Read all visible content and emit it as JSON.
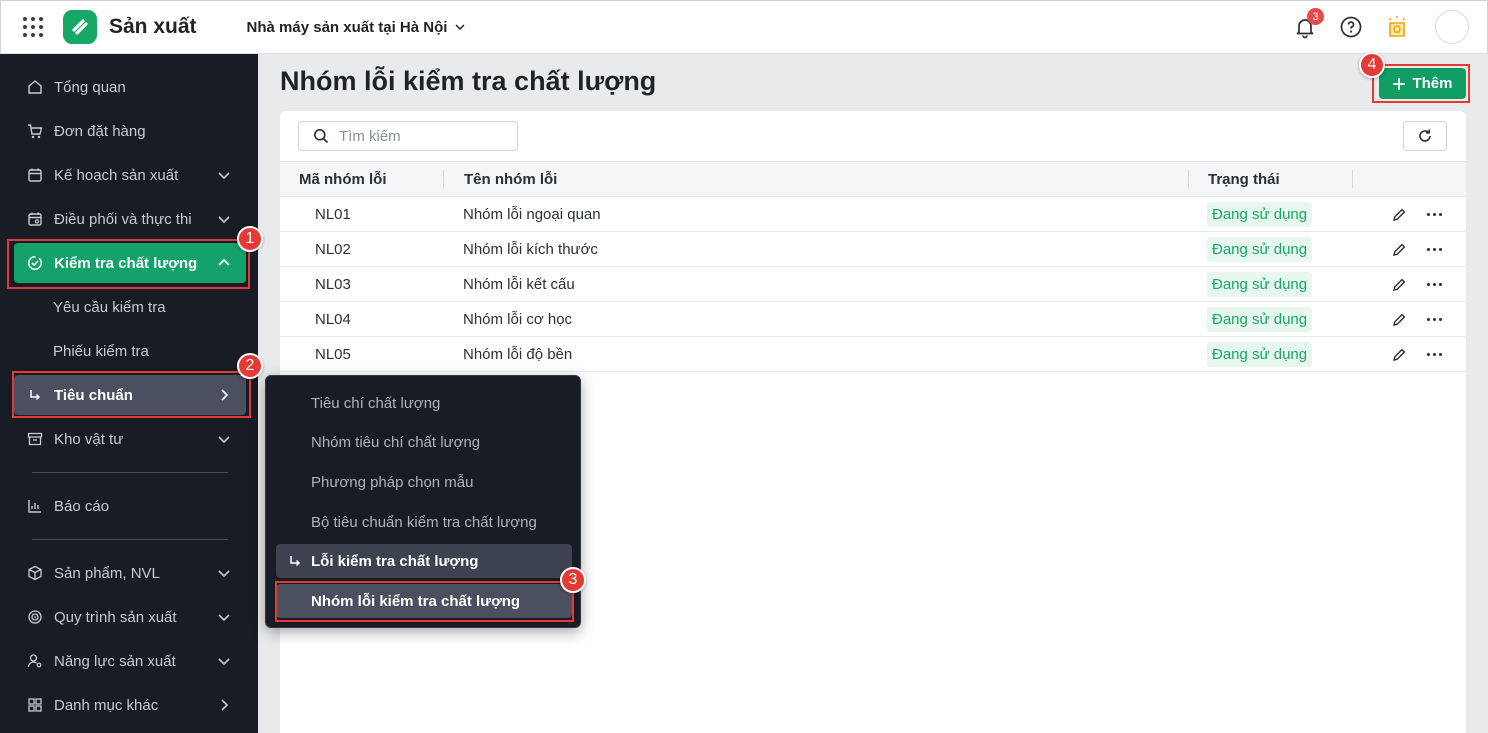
{
  "header": {
    "app_title": "Sản xuất",
    "factory": "Nhà máy sản xuất tại Hà Nội",
    "notification_count": "3"
  },
  "sidebar": {
    "items": [
      {
        "label": "Tổng quan",
        "icon": "home-icon"
      },
      {
        "label": "Đơn đặt hàng",
        "icon": "cart-icon"
      },
      {
        "label": "Kế hoạch sản xuất",
        "icon": "calendar-icon"
      },
      {
        "label": "Điều phối và thực thi",
        "icon": "calendar-gear-icon"
      },
      {
        "label": "Kiểm tra chất lượng",
        "icon": "check-circle-icon"
      },
      {
        "label": "Yêu cầu kiểm tra"
      },
      {
        "label": "Phiếu kiểm tra"
      },
      {
        "label": "Tiêu chuẩn",
        "icon": "subitem-arrow-icon"
      },
      {
        "label": "Kho vật tư",
        "icon": "archive-icon"
      },
      {
        "label": "Báo cáo",
        "icon": "chart-icon"
      },
      {
        "label": "Sản phẩm, NVL",
        "icon": "cube-icon"
      },
      {
        "label": "Quy trình sản xuất",
        "icon": "process-icon"
      },
      {
        "label": "Năng lực sản xuất",
        "icon": "user-gear-icon"
      },
      {
        "label": "Danh mục khác",
        "icon": "grid-icon"
      }
    ]
  },
  "flyout": {
    "items": [
      {
        "label": "Tiêu chí chất lượng"
      },
      {
        "label": "Nhóm tiêu chí chất lượng"
      },
      {
        "label": "Phương pháp chọn mẫu"
      },
      {
        "label": "Bộ tiêu chuẩn kiểm tra chất lượng"
      },
      {
        "label": "Lỗi kiểm tra chất lượng"
      },
      {
        "label": "Nhóm lỗi kiểm tra chất lượng"
      }
    ]
  },
  "main": {
    "title": "Nhóm lỗi kiểm tra chất lượng",
    "add_label": "Thêm",
    "search_placeholder": "Tìm kiếm",
    "columns": [
      "Mã nhóm lỗi",
      "Tên nhóm lỗi",
      "Trạng thái"
    ],
    "rows": [
      {
        "code": "NL01",
        "name": "Nhóm lỗi ngoại quan",
        "status": "Đang sử dụng"
      },
      {
        "code": "NL02",
        "name": "Nhóm lỗi kích thước",
        "status": "Đang sử dụng"
      },
      {
        "code": "NL03",
        "name": "Nhóm lỗi kết cấu",
        "status": "Đang sử dụng"
      },
      {
        "code": "NL04",
        "name": "Nhóm lỗi cơ học",
        "status": "Đang sử dụng"
      },
      {
        "code": "NL05",
        "name": "Nhóm lỗi độ bền",
        "status": "Đang sử dụng"
      }
    ]
  },
  "callouts": [
    "1",
    "2",
    "3",
    "4"
  ],
  "colors": {
    "accent": "#14a26a",
    "sidebar_bg": "#171c25",
    "callout_red": "#e53935",
    "status_green": "#17a865"
  }
}
